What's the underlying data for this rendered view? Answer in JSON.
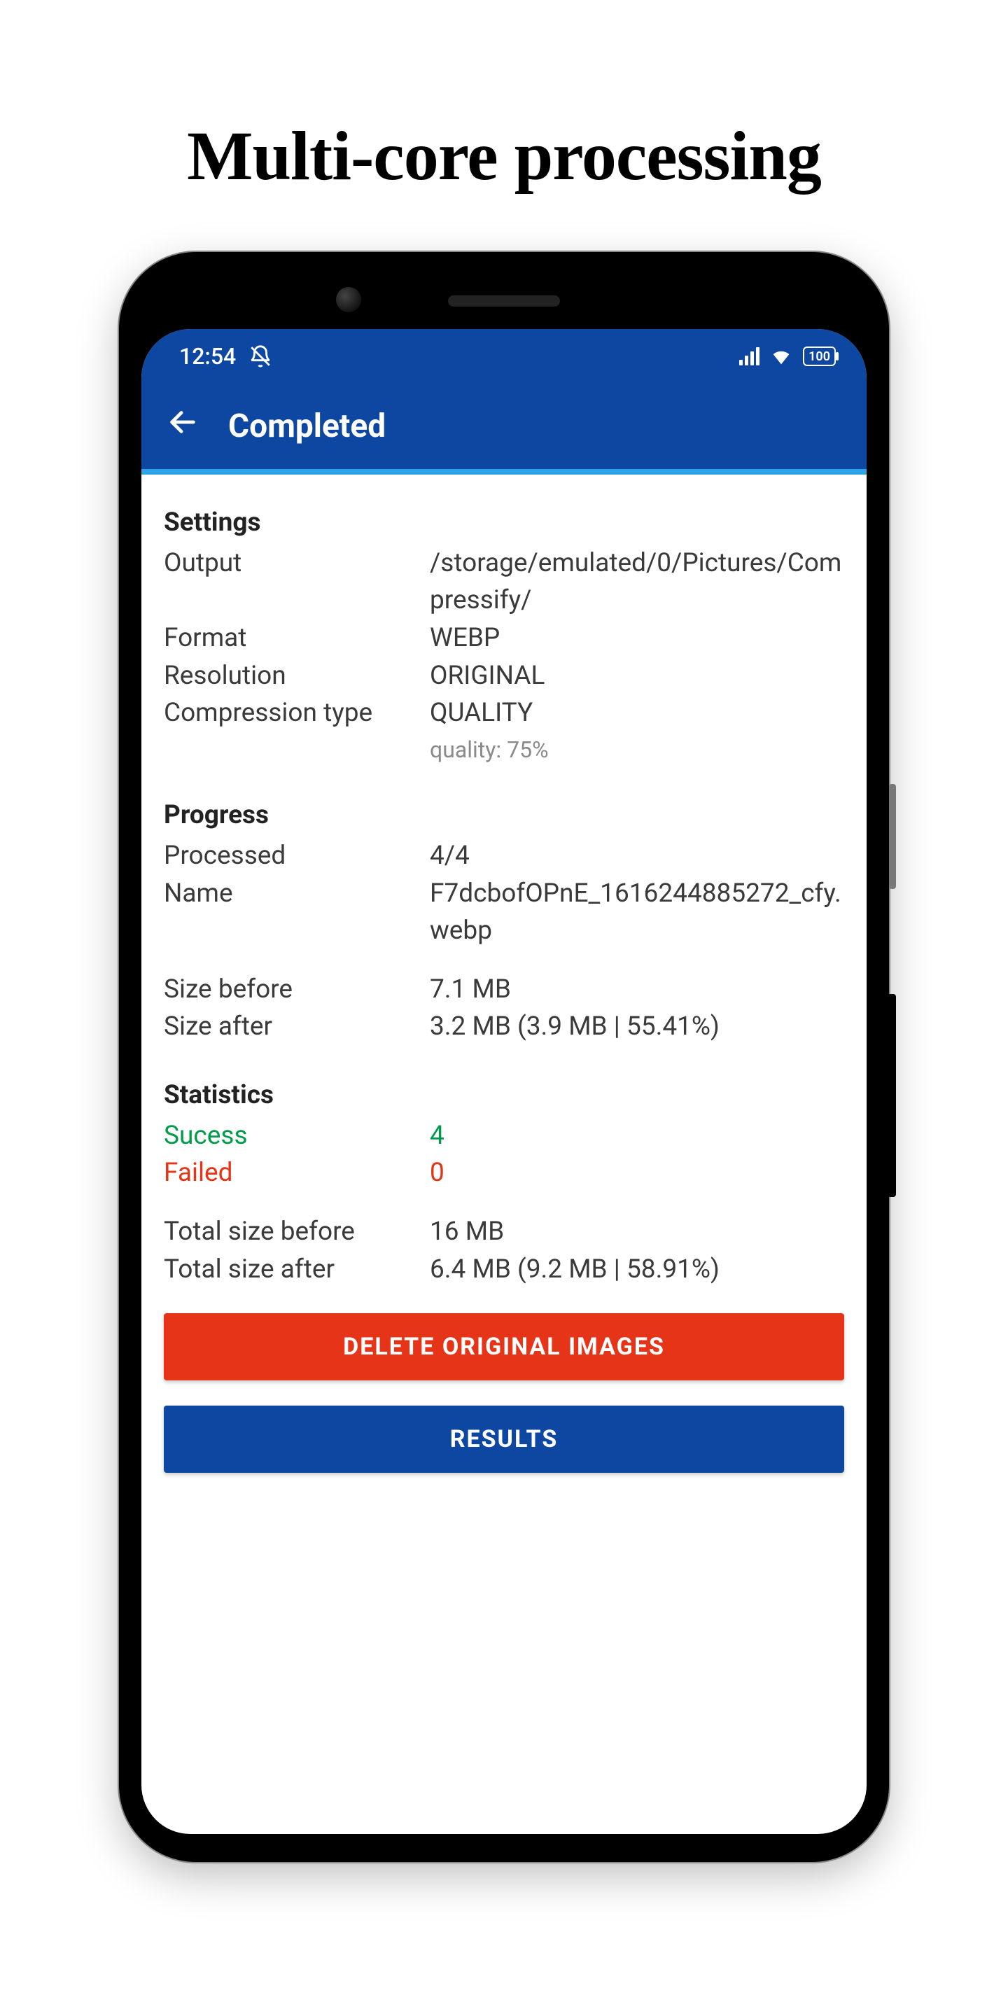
{
  "headline": "Multi-core processing",
  "statusbar": {
    "time": "12:54",
    "battery_label": "100"
  },
  "appbar": {
    "title": "Completed"
  },
  "settings": {
    "header": "Settings",
    "output_k": "Output",
    "output_v": "/storage/emulated/0/Pictures/Compressify/",
    "format_k": "Format",
    "format_v": "WEBP",
    "resolution_k": "Resolution",
    "resolution_v": "ORIGINAL",
    "compression_k": "Compression type",
    "compression_v": "QUALITY",
    "quality_sub": "quality: 75%"
  },
  "progress": {
    "header": "Progress",
    "processed_k": "Processed",
    "processed_v": "4/4",
    "name_k": "Name",
    "name_v": "F7dcbofOPnE_1616244885272_cfy.webp",
    "size_before_k": "Size before",
    "size_before_v": "7.1 MB",
    "size_after_k": "Size after",
    "size_after_v": "3.2 MB (3.9 MB | 55.41%)"
  },
  "statistics": {
    "header": "Statistics",
    "success_k": "Sucess",
    "success_v": "4",
    "failed_k": "Failed",
    "failed_v": "0",
    "total_before_k": "Total size before",
    "total_before_v": "16 MB",
    "total_after_k": "Total size after",
    "total_after_v": "6.4 MB (9.2 MB | 58.91%)"
  },
  "buttons": {
    "delete": "DELETE ORIGINAL IMAGES",
    "results": "RESULTS"
  }
}
